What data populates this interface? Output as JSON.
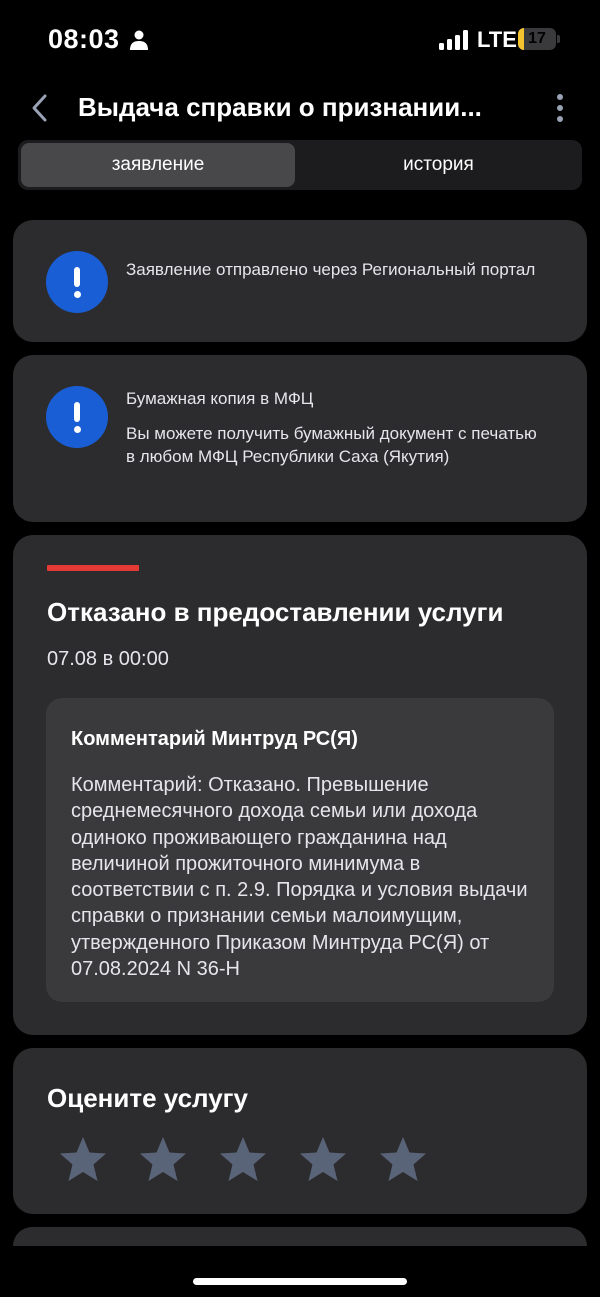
{
  "status_bar": {
    "time": "08:03",
    "network": "LTE",
    "battery_level": "17",
    "battery_fraction": 0.17,
    "icons": [
      "person-icon",
      "signal-icon",
      "battery-icon"
    ]
  },
  "header": {
    "title": "Выдача справки о признании...",
    "icons": [
      "back-chevron-icon",
      "more-vertical-icon"
    ]
  },
  "tabs": [
    {
      "label": "заявление",
      "active": true
    },
    {
      "label": "история",
      "active": false
    }
  ],
  "notices": [
    {
      "text": "Заявление отправлено через Региональный портал",
      "icon": "info-exclamation-icon"
    },
    {
      "title": "Бумажная копия в МФЦ",
      "text": "Вы можете получить бумажный документ с печатью в любом МФЦ Республики Саха (Якутия)",
      "icon": "info-exclamation-icon"
    }
  ],
  "status": {
    "title": "Отказано в предоставлении услуги",
    "date": "07.08 в 00:00",
    "comment_title": "Комментарий Минтруд РС(Я)",
    "comment_text": "Комментарий: Отказано. Превышение среднемесячного дохода семьи или дохода одиноко проживающего гражданина над величиной прожиточного минимума в соответствии с п. 2.9. Порядка и условия выдачи справки о признании семьи малоимущим, утвержденного Приказом Минтруда РС(Я) от 07.08.2024 N 36-Н"
  },
  "rating": {
    "title": "Оцените услугу",
    "max_stars": 5,
    "selected_stars": 0
  },
  "colors": {
    "background": "#000000",
    "card": "#2c2c2e",
    "comment_box": "#3a3a3c",
    "accent_blue": "#1a5ed6",
    "status_red": "#e53935",
    "star": "#5a6478",
    "battery": "#f4c430"
  }
}
